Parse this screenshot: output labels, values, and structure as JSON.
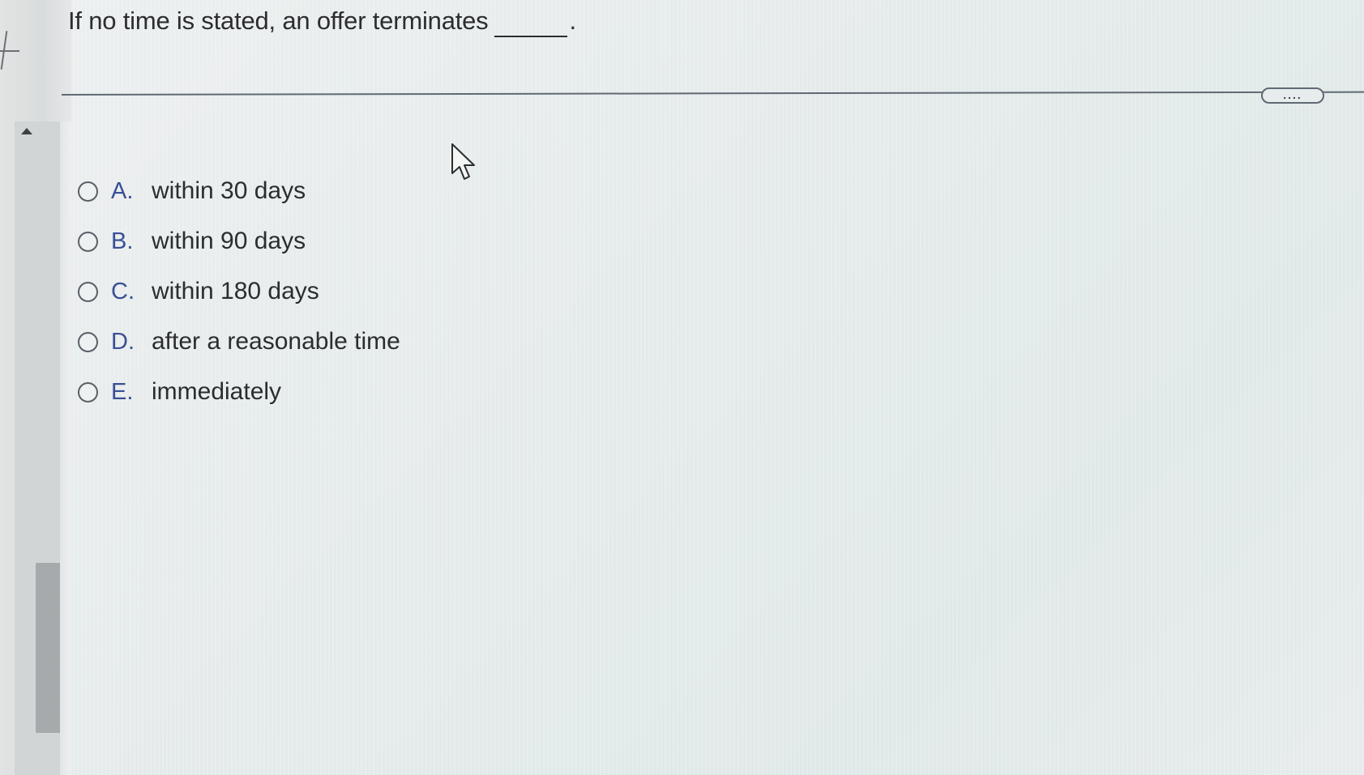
{
  "question": {
    "text": "If no time is stated, an offer terminates",
    "period": "."
  },
  "more_button": {
    "label": "...."
  },
  "options": [
    {
      "letter": "A.",
      "text": "within 30 days"
    },
    {
      "letter": "B.",
      "text": "within 90 days"
    },
    {
      "letter": "C.",
      "text": "within 180 days"
    },
    {
      "letter": "D.",
      "text": "after a reasonable time"
    },
    {
      "letter": "E.",
      "text": "immediately"
    }
  ],
  "colors": {
    "option_letter": "#3a4f96",
    "text": "#2b2d31",
    "separator": "#5f6a74"
  },
  "icons": {
    "cursor": "mouse-pointer-icon",
    "scroll_up": "caret-up-icon",
    "radio": "radio-unchecked-icon"
  }
}
